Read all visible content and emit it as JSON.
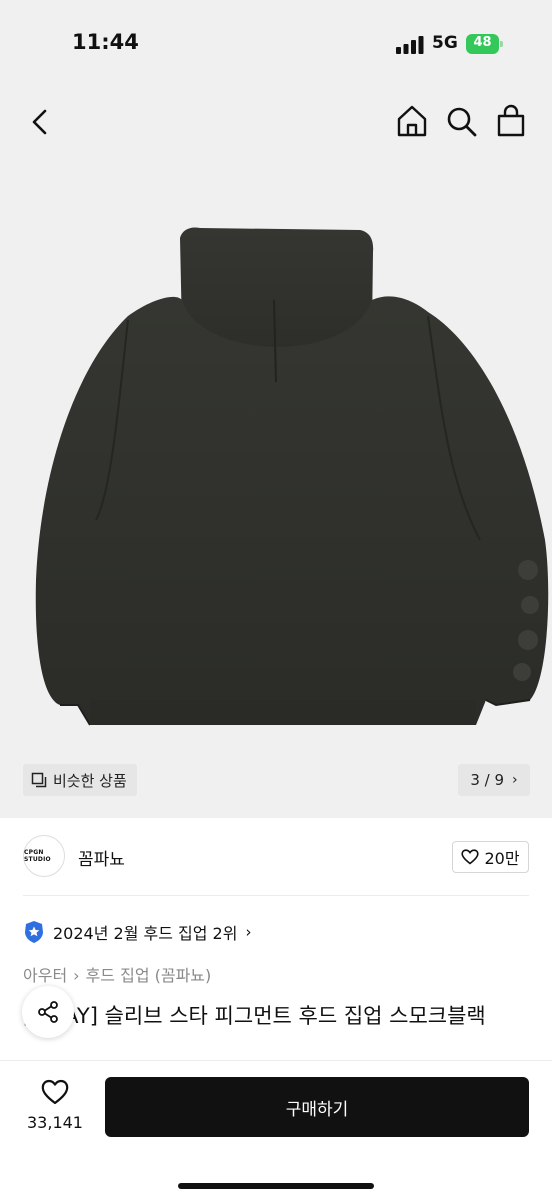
{
  "status_bar": {
    "time": "11:44",
    "network": "5G",
    "battery": "48"
  },
  "nav": {
    "icons": [
      "chevron-left-icon",
      "home-icon",
      "search-icon",
      "shopping-bag-icon"
    ]
  },
  "gallery": {
    "similar_label": "비슷한 상품",
    "page_indicator": "3 / 9",
    "image_subject": "dark charcoal pigment hooded zip-up, back view"
  },
  "shop": {
    "logo_text": "CPGN STUDIO",
    "name": "꼼파뇨",
    "like_count": "20만"
  },
  "ranking": {
    "text": "2024년 2월 후드 집업 2위"
  },
  "breadcrumb": [
    "아우터",
    "후드 집업 (꼼파뇨)"
  ],
  "product": {
    "title": "[2WAY] 슬리브 스타 피그먼트 후드 집업 스모크블랙"
  },
  "bottom_bar": {
    "wish_count": "33,141",
    "buy_label": "구매하기"
  },
  "colors": {
    "hoodie": "#2f302c",
    "background": "#f0f0f0",
    "buy_button": "#111111",
    "battery": "#34c759",
    "rank_badge": "#2f6fe0"
  }
}
